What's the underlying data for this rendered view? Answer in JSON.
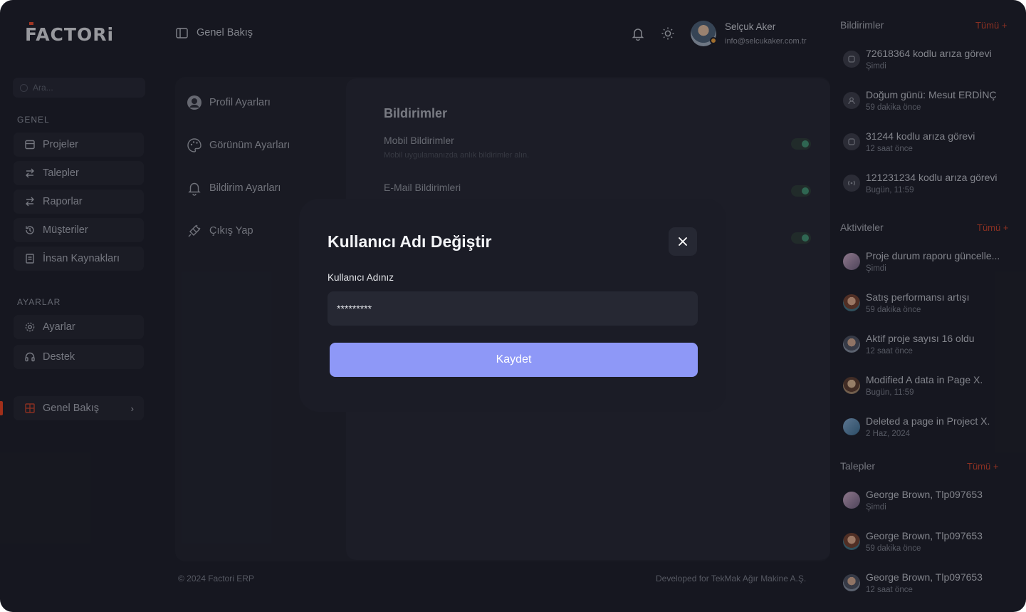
{
  "brand": {
    "logo": "FACTORi",
    "accent_color": "#e24a2b"
  },
  "search": {
    "placeholder": "Ara..."
  },
  "sidebar": {
    "general_title": "GENEL",
    "general_items": [
      {
        "label": "Projeler",
        "icon": "calendar-icon"
      },
      {
        "label": "Talepler",
        "icon": "swap-icon"
      },
      {
        "label": "Raporlar",
        "icon": "swap-icon"
      },
      {
        "label": "Müşteriler",
        "icon": "history-icon"
      },
      {
        "label": "İnsan Kaynakları",
        "icon": "document-icon"
      }
    ],
    "settings_title": "AYARLAR",
    "settings_items": [
      {
        "label": "Ayarlar",
        "icon": "gear-icon"
      },
      {
        "label": "Destek",
        "icon": "headset-icon"
      }
    ],
    "overview_item": {
      "label": "Genel Bakış",
      "icon": "grid-icon"
    }
  },
  "header": {
    "breadcrumb": "Genel Bakış",
    "user_name": "Selçuk Aker",
    "user_email": "info@selcukaker.com.tr"
  },
  "settings_menu": {
    "items": [
      "Profil Ayarları",
      "Görünüm Ayarları",
      "Bildirim Ayarları",
      "Çıkış Yap"
    ]
  },
  "settings_panel": {
    "title": "Bildirimler",
    "mobile_label": "Mobil Bildirimler",
    "mobile_desc": "Mobil uygulamanızda anlık bildirimler alın.",
    "email_label": "E-Mail Bildirimleri",
    "toggle_color": "#3f8e6f"
  },
  "modal": {
    "title": "Kullanıcı Adı Değiştir",
    "field_label": "Kullanıcı Adınız",
    "field_value": "*********",
    "save_label": "Kaydet",
    "button_color": "#8e98f7"
  },
  "footer": {
    "copyright": "© 2024 Factori ERP",
    "developed_for": "Developed for TekMak Ağır Makine A.Ş."
  },
  "notifications": {
    "title": "Bildirimler",
    "more": "Tümü +",
    "items": [
      {
        "title": "72618364 kodlu arıza görevi",
        "time": "Şimdi"
      },
      {
        "title": "Doğum günü: Mesut ERDİNÇ",
        "time": "59 dakika önce"
      },
      {
        "title": "31244 kodlu arıza görevi",
        "time": "12 saat önce"
      },
      {
        "title": "121231234 kodlu arıza görevi",
        "time": "Bugün, 11:59"
      }
    ]
  },
  "activities": {
    "title": "Aktiviteler",
    "more": "Tümü +",
    "items": [
      {
        "title": "Proje durum raporu güncelle...",
        "time": "Şimdi"
      },
      {
        "title": "Satış performansı artışı",
        "time": "59 dakika önce"
      },
      {
        "title": "Aktif proje sayısı 16 oldu",
        "time": "12 saat önce"
      },
      {
        "title": "Modified A data in Page X.",
        "time": "Bugün, 11:59"
      },
      {
        "title": "Deleted a page in Project X.",
        "time": "2 Haz, 2024"
      }
    ]
  },
  "requests": {
    "title": "Talepler",
    "more": "Tümü +",
    "items": [
      {
        "title": "George Brown, Tlp097653",
        "time": "Şimdi"
      },
      {
        "title": "George Brown, Tlp097653",
        "time": "59 dakika önce"
      },
      {
        "title": "George Brown, Tlp097653",
        "time": "12 saat önce"
      }
    ]
  }
}
